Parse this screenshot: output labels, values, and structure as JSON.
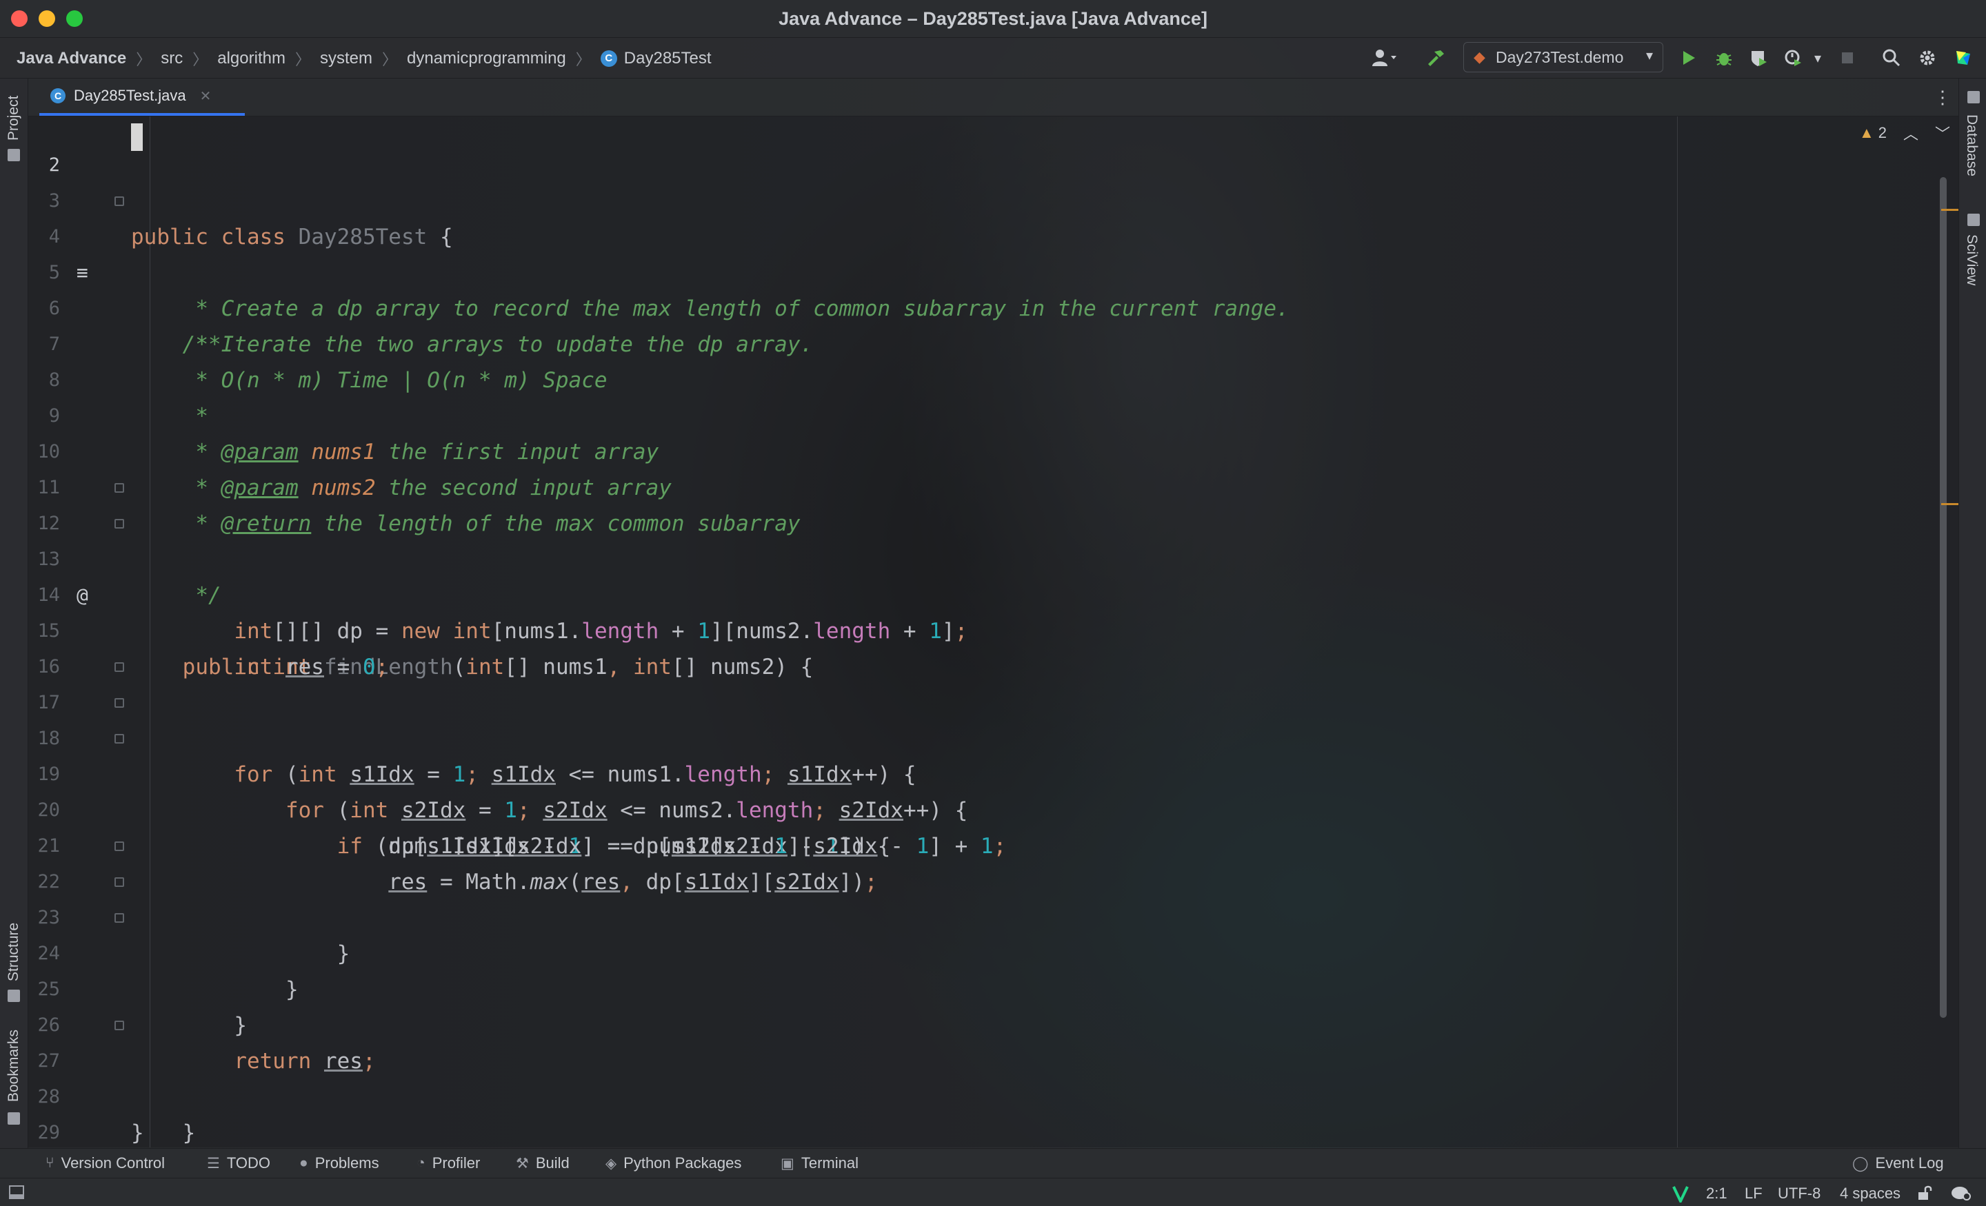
{
  "window": {
    "title": "Java Advance – Day285Test.java [Java Advance]"
  },
  "breadcrumb": {
    "items": [
      "Java Advance",
      "src",
      "algorithm",
      "system",
      "dynamicprogramming"
    ],
    "class_name": "Day285Test",
    "class_icon_letter": "C"
  },
  "toolbar": {
    "run_config": "Day273Test.demo",
    "icons": [
      "user-icon",
      "build-hammer-icon",
      "run-icon",
      "debug-icon",
      "coverage-icon",
      "profile-icon",
      "stop-icon",
      "search-icon",
      "gear-icon",
      "jetbrains-logo-icon"
    ]
  },
  "left_strip": {
    "top_label": "Project",
    "mid_label": "Structure",
    "bottom_label": "Bookmarks"
  },
  "right_strip": {
    "top_label": "Database",
    "mid_label": "SciView"
  },
  "tabs": [
    {
      "label": "Day285Test.java",
      "icon_letter": "C",
      "active": true
    }
  ],
  "editor": {
    "warnings_count": "2",
    "current_line": 2,
    "lines": [
      {
        "n": "2"
      },
      {
        "n": "3"
      },
      {
        "n": "4"
      },
      {
        "n": "5"
      },
      {
        "n": "6"
      },
      {
        "n": "7"
      },
      {
        "n": "8"
      },
      {
        "n": "9"
      },
      {
        "n": "10"
      },
      {
        "n": "11"
      },
      {
        "n": "12"
      },
      {
        "n": "13"
      },
      {
        "n": "14"
      },
      {
        "n": "15"
      },
      {
        "n": "16"
      },
      {
        "n": "17"
      },
      {
        "n": "18"
      },
      {
        "n": "19"
      },
      {
        "n": "20"
      },
      {
        "n": "21"
      },
      {
        "n": "22"
      },
      {
        "n": "23"
      },
      {
        "n": "24"
      },
      {
        "n": "25"
      },
      {
        "n": "26"
      },
      {
        "n": "27"
      },
      {
        "n": "28"
      },
      {
        "n": "29"
      }
    ],
    "code": {
      "l3_kw1": "public",
      "l3_kw2": "class",
      "l3_name": "Day285Test",
      "l3_rest": " {",
      "l4": "/**",
      "l5": " * Create a dp array to record the max length of common subarray in the current range.",
      "l6": " * Iterate the two arrays to update the dp array.",
      "l7": " * O(n * m) Time | O(n * m) Space",
      "l8": " *",
      "l9_a": " * ",
      "l9_tag": "@param",
      "l9_pn": "nums1",
      "l9_b": " the first input array",
      "l10_a": " * ",
      "l10_tag": "@param",
      "l10_pn": "nums2",
      "l10_b": " the second input array",
      "l11_a": " * ",
      "l11_tag": "@return",
      "l11_b": " the length of the max common subarray",
      "l12": " */",
      "l13": {
        "kw1": "public",
        "kw2": "int",
        "fn": "findLength",
        "p1": "(",
        "t1": "int",
        "p2": "[] nums1",
        "comma": ",",
        "t2": "int",
        "p3": "[] nums2) {"
      },
      "l14": {
        "kw1": "int",
        "a": "[][] dp = ",
        "kw2": "new",
        "kw3": "int",
        "b": "[nums1.",
        "f1": "length",
        "c": " + ",
        "n1": "1",
        "d": "][nums2.",
        "f2": "length",
        "e": " + ",
        "n2": "1",
        "f": "]",
        "semi": ";"
      },
      "l15": {
        "kw": "int",
        "v": "res",
        "a": " = ",
        "n": "0",
        "semi": ";"
      },
      "l17": {
        "kw1": "for",
        "a": " (",
        "kw2": "int",
        "v1": "s1Idx",
        "b": " = ",
        "n": "1",
        "semi1": ";",
        "v2": "s1Idx",
        "c": " <= nums1.",
        "f": "length",
        "semi2": ";",
        "v3": "s1Idx",
        "d": "++) {"
      },
      "l18": {
        "kw1": "for",
        "a": " (",
        "kw2": "int",
        "v1": "s2Idx",
        "b": " = ",
        "n": "1",
        "semi1": ";",
        "v2": "s2Idx",
        "c": " <= nums2.",
        "f": "length",
        "semi2": ";",
        "v3": "s2Idx",
        "d": "++) {"
      },
      "l19": {
        "kw": "if",
        "a": " (nums1[",
        "v1": "s1Idx",
        "b": " - ",
        "n1": "1",
        "c": "] == nums2[",
        "v2": "s2Idx",
        "d": " - ",
        "n2": "1",
        "e": "]) {"
      },
      "l20": {
        "a": "dp[",
        "v1": "s1Idx",
        "b": "][",
        "v2": "s2Idx",
        "c": "] = dp[",
        "v3": "s1Idx",
        "d": " - ",
        "n1": "1",
        "e": "][",
        "v4": "s2Idx",
        "f": " - ",
        "n2": "1",
        "g": "] + ",
        "n3": "1",
        "semi": ";"
      },
      "l21": {
        "v1": "res",
        "a": " = Math.",
        "st": "max",
        "b": "(",
        "v2": "res",
        "comma": ",",
        "c": " dp[",
        "v3": "s1Idx",
        "d": "][",
        "v4": "s2Idx",
        "e": "])",
        "semi": ";"
      },
      "l22": "}",
      "l23": "}",
      "l24": "}",
      "l26": {
        "kw": "return",
        "v": "res",
        "semi": ";"
      },
      "l27": "}",
      "l28": "}"
    }
  },
  "bottom_tools": [
    {
      "label": "Version Control",
      "icon": "branch-icon"
    },
    {
      "label": "TODO",
      "icon": "list-icon"
    },
    {
      "label": "Problems",
      "icon": "problems-icon"
    },
    {
      "label": "Profiler",
      "icon": "profiler-icon"
    },
    {
      "label": "Build",
      "icon": "hammer-icon"
    },
    {
      "label": "Python Packages",
      "icon": "packages-icon"
    },
    {
      "label": "Terminal",
      "icon": "terminal-icon"
    }
  ],
  "event_log": "Event Log",
  "status": {
    "position": "2:1",
    "line_sep": "LF",
    "encoding": "UTF-8",
    "indent": "4 spaces"
  },
  "colors": {
    "keyword": "#cf8e6d",
    "comment": "#5f9e5f",
    "number": "#2aacb8",
    "field": "#c77dbb",
    "accent": "#3574f0"
  }
}
